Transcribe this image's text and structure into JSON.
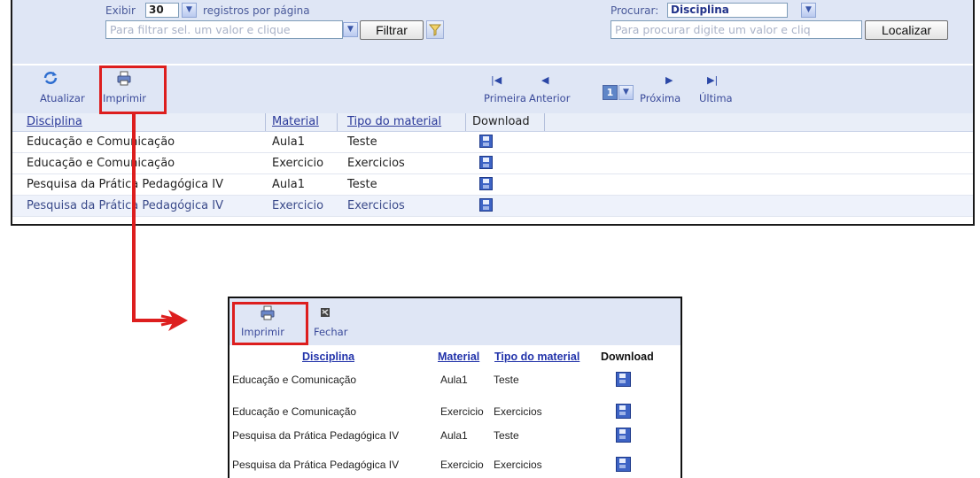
{
  "top": {
    "filter": {
      "show_label": "Exibir",
      "per_page_value": "30",
      "per_page_suffix": "registros por página",
      "filter_placeholder": "Para filtrar sel. um valor e clique",
      "filter_button": "Filtrar",
      "search_label": "Procurar:",
      "search_field_value": "Disciplina",
      "search_placeholder": "Para procurar digite um valor e cliq",
      "locate_button": "Localizar"
    },
    "toolbar": {
      "refresh": "Atualizar",
      "print": "Imprimir",
      "first": "Primeira",
      "previous": "Anterior",
      "page": "1",
      "next": "Próxima",
      "last": "Última"
    },
    "columns": [
      "Disciplina",
      "Material",
      "Tipo do material",
      "Download"
    ],
    "rows": [
      {
        "disciplina": "Educação e Comunicação",
        "material": "Aula1",
        "tipo": "Teste"
      },
      {
        "disciplina": "Educação e Comunicação",
        "material": "Exercicio",
        "tipo": "Exercicios"
      },
      {
        "disciplina": "Pesquisa da Prática Pedagógica IV",
        "material": "Aula1",
        "tipo": "Teste"
      },
      {
        "disciplina": "Pesquisa da Prática Pedagógica IV",
        "material": "Exercicio",
        "tipo": "Exercicios"
      }
    ]
  },
  "bottom": {
    "toolbar": {
      "print": "Imprimir",
      "close": "Fechar"
    },
    "columns": [
      "Disciplina",
      "Material",
      "Tipo do material",
      "Download"
    ],
    "rows": [
      {
        "disciplina": "Educação e Comunicação",
        "material": "Aula1",
        "tipo": "Teste"
      },
      {
        "disciplina": "Educação e Comunicação",
        "material": "Exercicio",
        "tipo": "Exercicios"
      },
      {
        "disciplina": "Pesquisa da Prática Pedagógica IV",
        "material": "Aula1",
        "tipo": "Teste"
      },
      {
        "disciplina": "Pesquisa da Prática Pedagógica IV",
        "material": "Exercicio",
        "tipo": "Exercicios"
      }
    ]
  },
  "colors": {
    "highlight": "#dd1e1e",
    "panel_bg": "#dfe6f5",
    "link": "#2b3a9a",
    "save_icon": "#3d63c4"
  },
  "icons": [
    "refresh-icon",
    "printer-icon",
    "first-page-icon",
    "previous-page-icon",
    "next-page-icon",
    "last-page-icon",
    "funnel-icon",
    "close-icon",
    "save-icon",
    "chevron-down-icon",
    "arrow-connector"
  ]
}
